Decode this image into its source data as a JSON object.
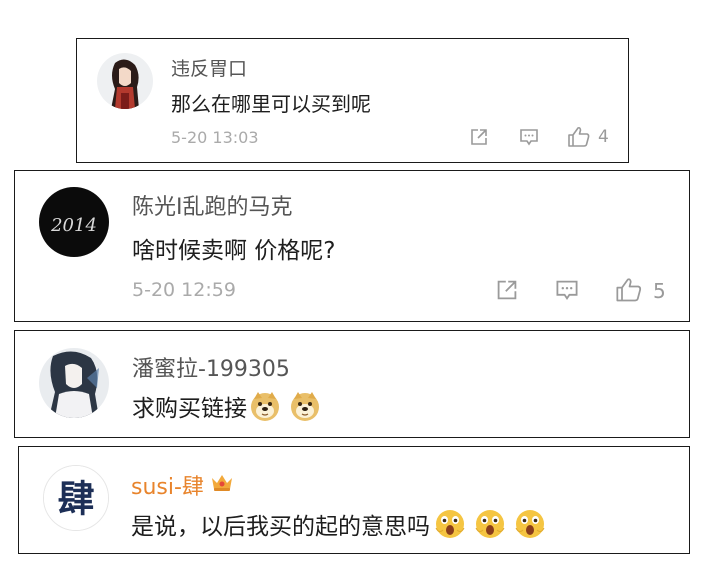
{
  "comments": [
    {
      "username": "违反胃口",
      "text": "那么在哪里可以买到呢",
      "time": "5-20 13:03",
      "likes": "4",
      "avatar_icon": "anime-girl-avatar"
    },
    {
      "username": "陈光I乱跑的马克",
      "text": "啥时候卖啊 价格呢?",
      "time": "5-20 12:59",
      "likes": "5",
      "avatar_icon": "2014-black-avatar",
      "avatar_text": "2014"
    },
    {
      "username": "潘蜜拉-199305",
      "text": "求购买链接",
      "emoji_icons": [
        "doge-emoji",
        "doge-emoji"
      ],
      "avatar_icon": "ink-painting-avatar"
    },
    {
      "username": "susi-肆",
      "username_color": "#e8842c",
      "text": "是说，以后我买的起的意思吗",
      "emoji_icons": [
        "shocked-face-emoji",
        "shocked-face-emoji",
        "shocked-face-emoji"
      ],
      "avatar_icon": "calligraphy-character-avatar",
      "avatar_text": "肆",
      "badge_icon": "crown-vip-badge-icon"
    }
  ],
  "colors": {
    "username": "#555555",
    "text": "#1e1e1e",
    "meta": "#aaaaaa",
    "vip_name": "#e8842c",
    "card_border": "#1a1a1a"
  }
}
